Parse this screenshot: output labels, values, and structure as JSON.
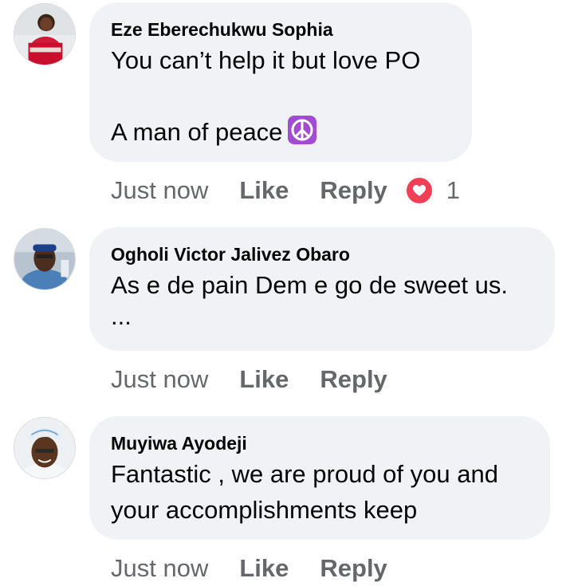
{
  "comments": [
    {
      "author": "Eze Eberechukwu Sophia",
      "line1": "You can’t help it but love PO",
      "line2": "",
      "line3": "A man of peace",
      "emoji_icon": "peace-symbol-icon",
      "time": "Just now",
      "like": "Like",
      "reply": "Reply",
      "reaction_icon": "heart-reaction-icon",
      "reaction_count": "1"
    },
    {
      "author": "Ogholi Victor Jalivez Obaro",
      "line1": "As e de pain Dem e go de sweet us.",
      "line2": "...",
      "time": "Just now",
      "like": "Like",
      "reply": "Reply"
    },
    {
      "author": "Muyiwa Ayodeji",
      "line1": "Fantastic , we are proud of you and",
      "line2": "your accomplishments keep",
      "time": "Just now",
      "like": "Like",
      "reply": "Reply"
    }
  ],
  "colors": {
    "bubble": "#f0f2f5",
    "meta_text": "#65676b",
    "heart": "#f33e58",
    "peace_emoji": "#a24dd1"
  }
}
